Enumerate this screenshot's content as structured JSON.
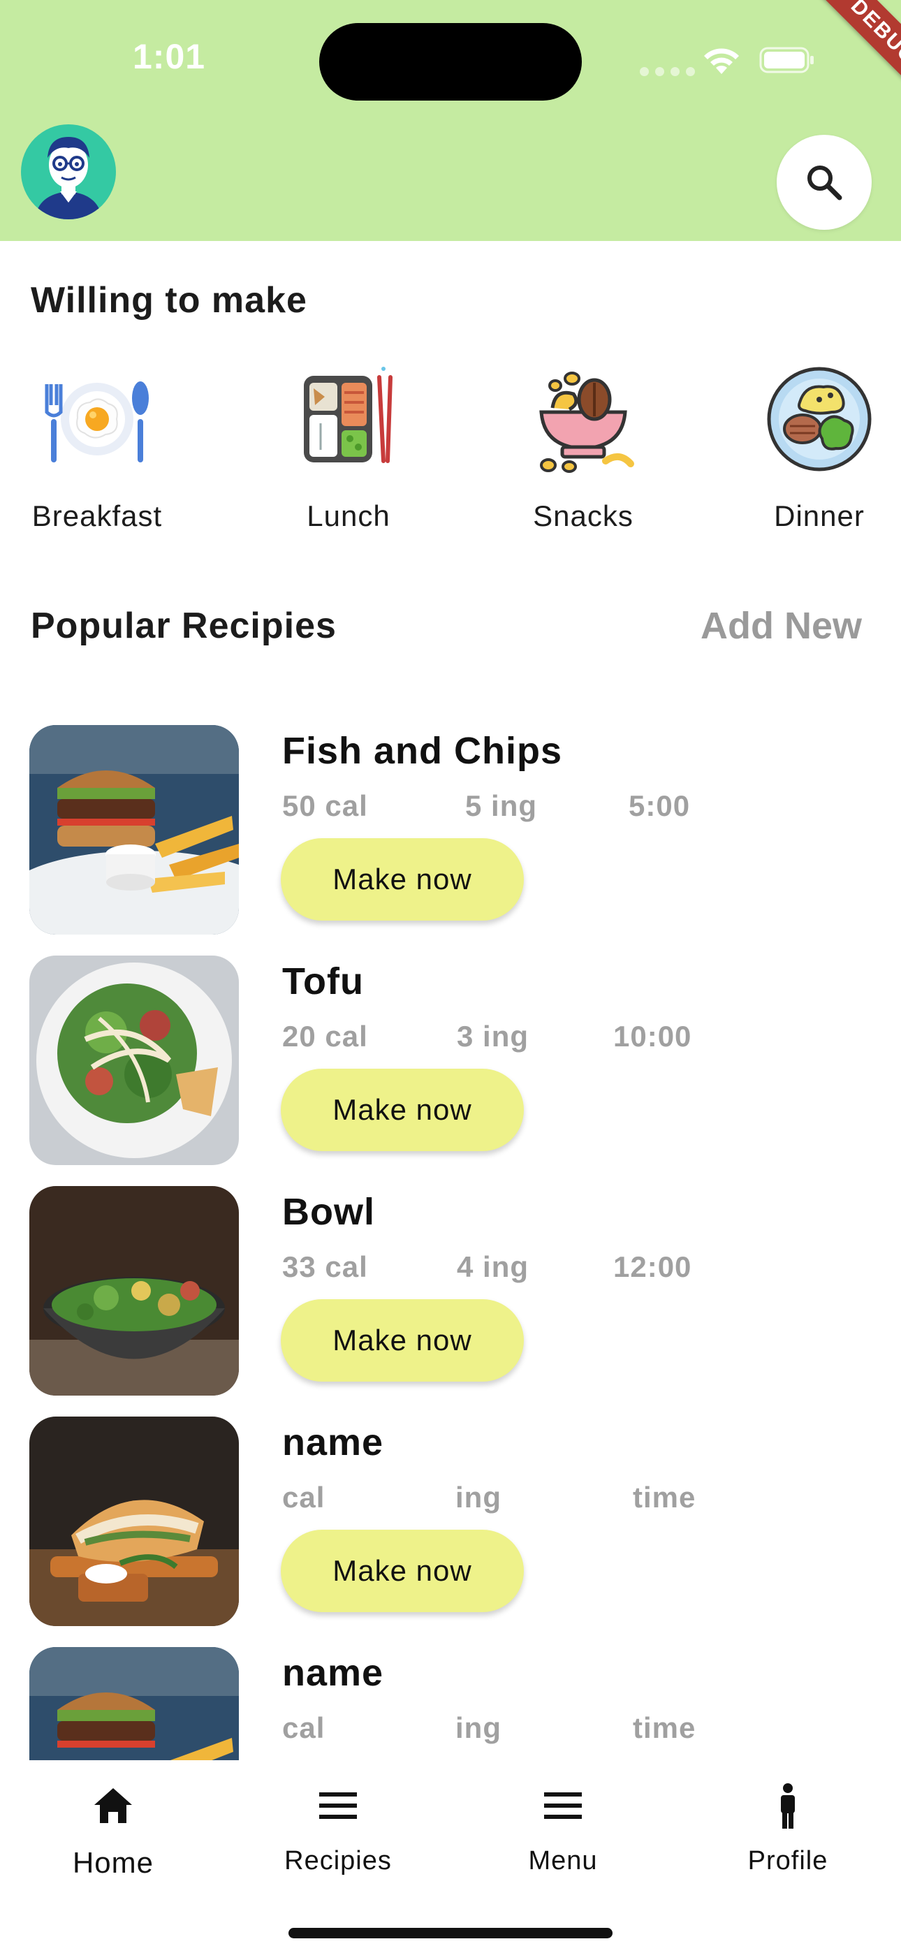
{
  "status_bar": {
    "time": "1:01",
    "debug_label": "DEBUG"
  },
  "header": {
    "avatar_icon": "user-avatar-icon",
    "search_icon": "search-icon"
  },
  "willing": {
    "title": "Willing to make",
    "categories": [
      {
        "label": "Breakfast",
        "icon": "breakfast-icon"
      },
      {
        "label": "Lunch",
        "icon": "lunch-icon"
      },
      {
        "label": "Snacks",
        "icon": "snacks-icon"
      },
      {
        "label": "Dinner",
        "icon": "dinner-icon"
      }
    ]
  },
  "popular": {
    "title": "Popular Recipies",
    "add_new": "Add New",
    "recipes": [
      {
        "name": "Fish and Chips",
        "cal": "50 cal",
        "ing": "5 ing",
        "time": "5:00",
        "button": "Make now",
        "image": "burger-photo"
      },
      {
        "name": "Tofu",
        "cal": "20 cal",
        "ing": "3 ing",
        "time": "10:00",
        "button": "Make now",
        "image": "salad-photo"
      },
      {
        "name": "Bowl",
        "cal": "33 cal",
        "ing": "4 ing",
        "time": "12:00",
        "button": "Make now",
        "image": "bowl-photo"
      },
      {
        "name": "name",
        "cal": "cal",
        "ing": "ing",
        "time": "time",
        "button": "Make now",
        "image": "sandwich-photo"
      },
      {
        "name": "name",
        "cal": "cal",
        "ing": "ing",
        "time": "time",
        "image": "burger-photo"
      }
    ]
  },
  "bottom_nav": [
    {
      "label": "Home",
      "icon": "home-icon"
    },
    {
      "label": "Recipies",
      "icon": "menu-icon"
    },
    {
      "label": "Menu",
      "icon": "menu-icon"
    },
    {
      "label": "Profile",
      "icon": "person-icon"
    }
  ],
  "colors": {
    "header_bg": "#c5eba1",
    "button_bg": "#eef28a",
    "muted_text": "#a0a0a0"
  }
}
